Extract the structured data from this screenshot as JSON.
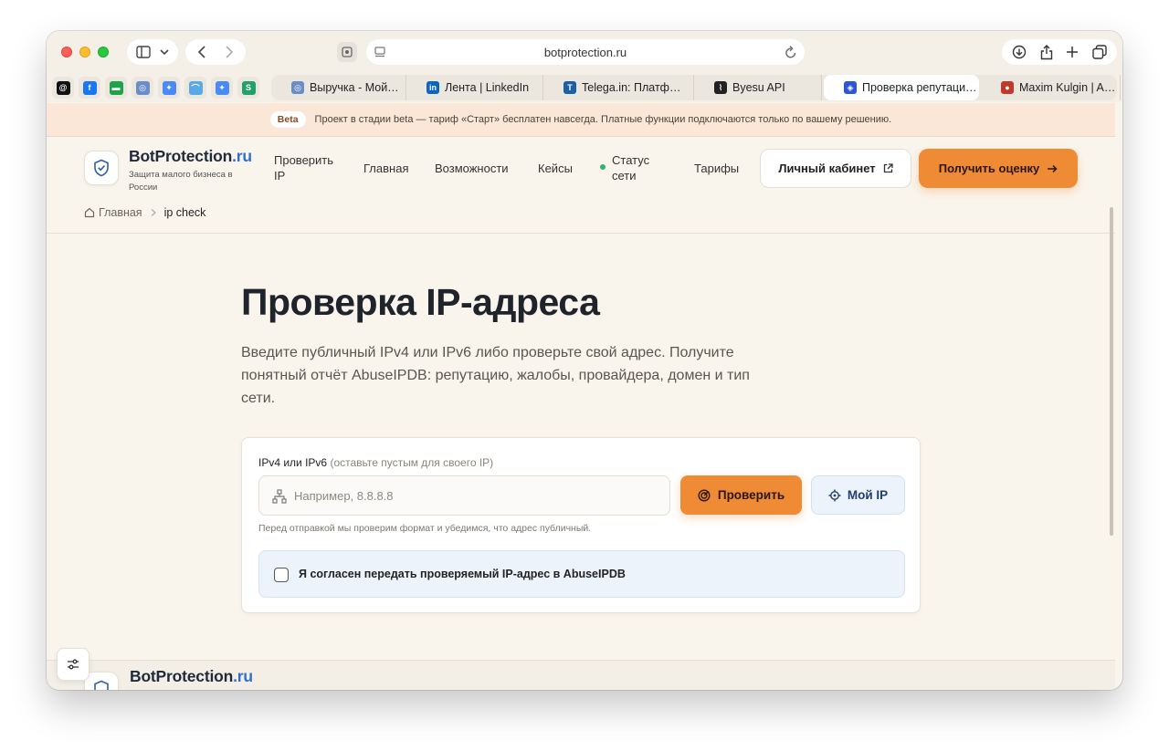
{
  "browser": {
    "url": "botprotection.ru",
    "pinned": [
      {
        "name": "threads-icon",
        "glyph": "@",
        "color": "#111111"
      },
      {
        "name": "facebook-icon",
        "glyph": "f",
        "color": "#1877f2"
      },
      {
        "name": "green-app-icon",
        "glyph": "▬",
        "color": "#1fa34a"
      },
      {
        "name": "globe-icon",
        "glyph": "◎",
        "color": "#6a8cc7"
      },
      {
        "name": "gemini-icon",
        "glyph": "✦",
        "color": "#4a8af4"
      },
      {
        "name": "arc-icon",
        "glyph": "⌒",
        "color": "#5aa9e6"
      },
      {
        "name": "gemini-icon-2",
        "glyph": "✦",
        "color": "#4a8af4"
      },
      {
        "name": "s-app-icon",
        "glyph": "S",
        "color": "#22a06b"
      }
    ],
    "tabs": [
      {
        "title": "Выручка - Мой…",
        "fav": "◎",
        "fav_color": "#6a8cc7"
      },
      {
        "title": "Лента | LinkedIn",
        "fav": "in",
        "fav_color": "#0a66c2"
      },
      {
        "title": "Telega.in: Платф…",
        "fav": "T",
        "fav_color": "#1b5fa8"
      },
      {
        "title": "Byesu API",
        "fav": "⌇",
        "fav_color": "#222222"
      },
      {
        "title": "Проверка репутаци…",
        "fav": "◈",
        "fav_color": "#2f55d4"
      },
      {
        "title": "Maxim Kulgin | A…",
        "fav": "●",
        "fav_color": "#c0392b"
      }
    ]
  },
  "beta": {
    "badge": "Beta",
    "text": "Проект в стадии beta — тариф «Старт» бесплатен навсегда. Платные функции подключаются только по вашему решению."
  },
  "header": {
    "brand_main": "BotProtection",
    "brand_tld": ".ru",
    "tagline": "Защита малого бизнеса в России",
    "nav": {
      "check_ip": "Проверить IP",
      "home": "Главная",
      "features": "Возможности",
      "cases": "Кейсы",
      "status": "Статус сети",
      "pricing": "Тарифы"
    },
    "cabinet": "Личный кабинет",
    "estimate": "Получить оценку"
  },
  "breadcrumb": {
    "home": "Главная",
    "current": "ip check"
  },
  "hero": {
    "title": "Проверка IP-адреса",
    "subtitle": "Введите публичный IPv4 или IPv6 либо проверьте свой адрес. Получите понятный отчёт AbuseIPDB: репутацию, жалобы, провайдера, домен и тип сети."
  },
  "form": {
    "label": "IPv4 или IPv6",
    "label_hint": "(оставьте пустым для своего IP)",
    "placeholder": "Например, 8.8.8.8",
    "value": "",
    "check_button": "Проверить",
    "my_ip_button": "Мой IP",
    "helper": "Перед отправкой мы проверим формат и убедимся, что адрес публичный.",
    "consent": "Я согласен передать проверяемый IP-адрес в AbuseIPDB",
    "consent_checked": false
  },
  "footer": {
    "brand_main": "BotProtection",
    "brand_tld": ".ru"
  },
  "colors": {
    "accent": "#ef8a35",
    "brand_blue": "#2f6fcf",
    "status_green": "#2fb56a"
  }
}
